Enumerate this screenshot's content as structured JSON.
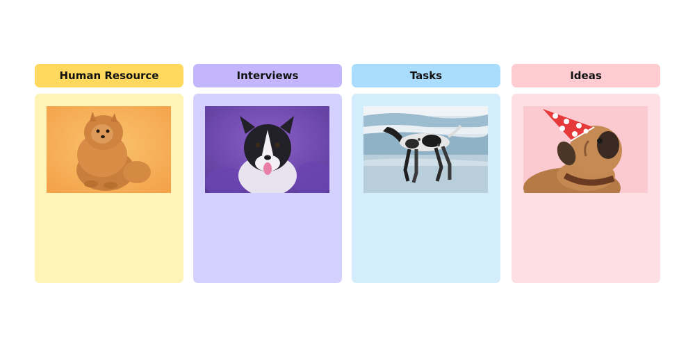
{
  "columns": [
    {
      "title": "Human Resource",
      "header_color": "#ffd95e",
      "body_color": "#fff4b8",
      "icon": "pomeranian-dog-photo"
    },
    {
      "title": "Interviews",
      "header_color": "#c3b6fc",
      "body_color": "#d4d1fe",
      "icon": "border-collie-dog-photo"
    },
    {
      "title": "Tasks",
      "header_color": "#aadcfd",
      "body_color": "#d3edfd",
      "icon": "pointer-dog-beach-photo"
    },
    {
      "title": "Ideas",
      "header_color": "#fecbd1",
      "body_color": "#fee0e4",
      "icon": "pug-party-hat-photo"
    }
  ]
}
